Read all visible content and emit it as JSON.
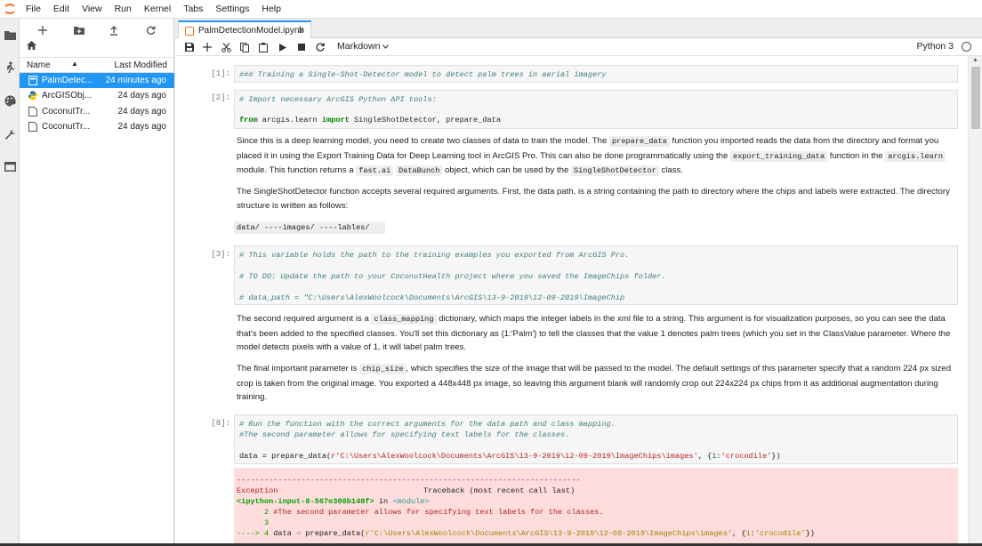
{
  "menubar": {
    "items": [
      "File",
      "Edit",
      "View",
      "Run",
      "Kernel",
      "Tabs",
      "Settings",
      "Help"
    ]
  },
  "file_browser": {
    "columns": {
      "name": "Name",
      "modified": "Last Modified"
    },
    "files": [
      {
        "name": "PalmDetec...",
        "modified": "24 minutes ago",
        "selected": true,
        "icon": "notebook-icon"
      },
      {
        "name": "ArcGISObj...",
        "modified": "24 days ago",
        "selected": false,
        "icon": "python-icon"
      },
      {
        "name": "CoconutTr...",
        "modified": "24 days ago",
        "selected": false,
        "icon": "file-icon"
      },
      {
        "name": "CoconutTr...",
        "modified": "24 days ago",
        "selected": false,
        "icon": "file-icon"
      }
    ]
  },
  "tab": {
    "label": "PalmDetectionModel.ipynb",
    "close": "×"
  },
  "toolbar": {
    "cell_type": "Markdown",
    "kernel": "Python 3"
  },
  "cells": {
    "c1": {
      "prompt": "[1]:",
      "line1": "### Training a Single-Shot-Detector model to detect palm trees in aerial imagery"
    },
    "c2": {
      "prompt": "[2]:",
      "line1": "# Import necessary ArcGIS Python API tools:",
      "line2_kw1": "from",
      "line2_mod": " arcgis.learn ",
      "line2_kw2": "import",
      "line2_rest": " SingleShotDetector, prepare_data"
    },
    "md1": {
      "t1": "Since this is a deep learning model, you need to create two classes of data to train the model. The ",
      "c1": "prepare_data",
      "t2": " function you imported reads the data from the directory and format you placed it in using the Export Training Data for Deep Learning tool in ArcGIS Pro. This can also be done programmatically using the ",
      "c2": "export_training_data",
      "t3": " function in the ",
      "c3": "arcgis.learn",
      "t4": " module. This function returns a ",
      "c4": "fast.ai",
      "t5": " ",
      "c5": "DataBunch",
      "t6": " object, which can be used by the ",
      "c6": "SingleShotDetector",
      "t7": " class."
    },
    "md2": {
      "text": "The SingleShotDetector function accepts several required arguments. First, the data path, is a string containing the path to directory where the chips and labels were extracted. The directory structure is written as follows:"
    },
    "md3": {
      "code": "data/ ----images/ ----lables/"
    },
    "c3": {
      "prompt": "[3]:",
      "line1": "# This variable holds the path to the training examples you exported from ArcGIS Pro.",
      "line2": "# TO DO: Update the path to your CoconutHealth project where you saved the ImageChips folder.",
      "line3": "# data_path = \"C:\\Users\\AlexWoolcock\\Documents\\ArcGIS\\13-9-2019\\12-09-2019\\ImageChip"
    },
    "md4": {
      "t1": "The second required argument is a ",
      "c1": "class_mapping",
      "t2": " dictionary, which maps the integer labels in the xml file to a string. This argument is for visualization purposes, so you can see the data that's been added to the specified classes. You'll set this dictionary as {1:'Palm'} to tell the classes that the value 1 denotes palm trees (which you set in the ClassValue parameter. Where the model detects pixels with a value of 1, it will label palm trees."
    },
    "md5": {
      "t1": "The final important parameter is ",
      "c1": "chip_size",
      "t2": ", which specifies the size of the image that will be passed to the model. The default settings of this parameter specify that a random 224 px sized crop is taken from the original image. You exported a 448x448 px image, so leaving this argument blank will randomly crop out 224x224 px chips from it as additional augmentation during training."
    },
    "c4": {
      "prompt": "[8]:",
      "line1": "# Run the function with the correct arguments for the data path and class mapping.",
      "line2": "#The second parameter allows for specifying text labels for the classes.",
      "line3_a": "data = prepare_data(",
      "line3_str": "r'C:\\Users\\AlexWoolcock\\Documents\\ArcGIS\\13-9-2019\\12-09-2019\\ImageChips\\images'",
      "line3_b": ", {",
      "line3_num": "1",
      "line3_c": ":",
      "line3_str2": "'crocodile'",
      "line3_d": "})"
    },
    "error": {
      "dashes": "---------------------------------------------------------------------------",
      "exc": "Exception",
      "tb": "Traceback (most recent call last)",
      "input": "<ipython-input-8-567e308b148f>",
      "in": " in ",
      "module": "<module>",
      "l2_num": "      2 ",
      "l2_text": "#The second parameter allows for specifying text labels for the classes.",
      "l3_num": "      3",
      "l4_arrow": "----> 4 ",
      "l4_a": "data ",
      "l4_eq": "=",
      "l4_b": " prepare_data(",
      "l4_str": "r'C:\\Users\\AlexWoolcock\\Documents\\ArcGIS\\13-9-2019\\12-09-2019\\ImageChips\\images'",
      "l4_c": ", {",
      "l4_num": "1",
      "l4_d": ":",
      "l4_str2": "'crocodile'",
      "l4_e": "})"
    }
  }
}
